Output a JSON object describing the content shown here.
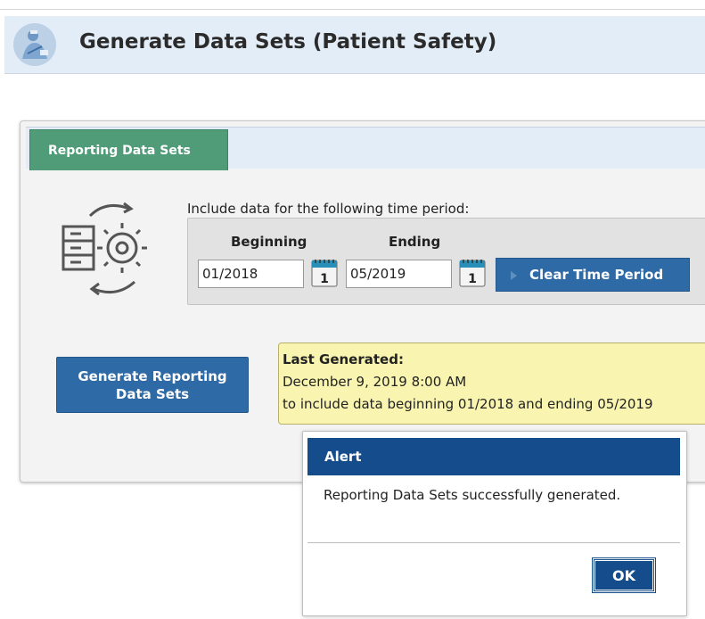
{
  "header": {
    "title": "Generate Data Sets (Patient Safety)",
    "logo_icon": "patient-safety-logo-icon"
  },
  "tabs": [
    {
      "label": "Reporting Data Sets",
      "active": true,
      "color": "#519c78"
    }
  ],
  "time_period": {
    "label": "Include data for the following time period:",
    "beginning_label": "Beginning",
    "ending_label": "Ending",
    "beginning_value": "01/2018",
    "ending_value": "05/2019",
    "calendar_icon": "calendar-icon",
    "calendar_day": "1",
    "clear_button": "Clear Time Period"
  },
  "generate_button": "Generate Reporting Data Sets",
  "last_generated": {
    "title": "Last Generated:",
    "date": "December 9, 2019 8:00 AM",
    "range_text": "to include data beginning 01/2018 and ending 05/2019"
  },
  "alert": {
    "title": "Alert",
    "message": "Reporting Data Sets successfully generated.",
    "ok_button": "OK"
  },
  "colors": {
    "header_bg": "#e3edf7",
    "button_blue": "#2e6aa5",
    "alert_blue": "#154d8c",
    "note_yellow": "#f9f5b0"
  }
}
